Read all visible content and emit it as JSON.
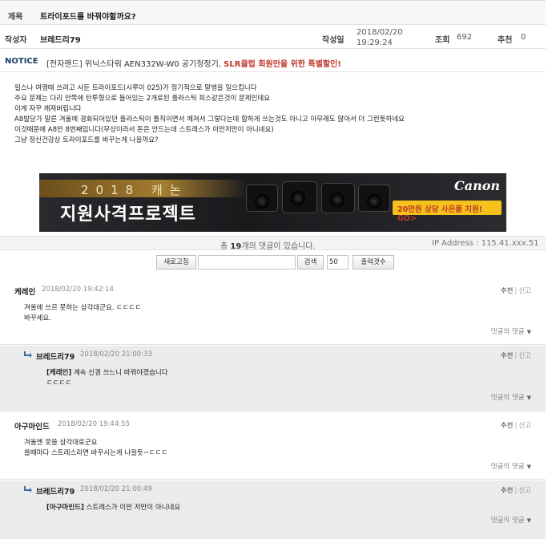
{
  "post": {
    "title_label": "제목",
    "title": "트라이포드를 바꿔야할까요?",
    "author_label": "작성자",
    "author": "브레드리79",
    "date_label": "작성일",
    "date": "2018/02/20",
    "time": "19:29:24",
    "views_label": "조회",
    "views": "692",
    "recommend_label": "추천",
    "recommend": "0"
  },
  "notice": {
    "tag": "NOTICE",
    "text": "[전자랜드] 위닉스타워 AEN332W-W0 공기청정기, ",
    "highlight": "SLR클럽 회원만을 위한 특별할인!"
  },
  "body_lines": [
    "필스나 여행때 쓰려고 사둔 트라이포드(시루이 025)가 정기적으로 말썽을 일으킵니다",
    "주요 문제는 다리 안쪽에 탄투형으로 들어있는 2개로된 플라스틱 피스같은것이 문제인데요",
    "이게 자꾸 깨져버립니다",
    "A8발당가 말른 겨울에 경화되어있던 플라스틱이 틀직이면서 깨져서 그렇다는데 함하게 쓰는것도 아니고 아무래도 않아서 더 그런듯하네요",
    "이것때문에 A8만 8번째입니다(무상이라서 돈은 안드는데 스트레스가 이만저만이 아니네요)",
    "그냥 정신건강상 트라이포드를 바꾸는게 나을까요?"
  ],
  "banner": {
    "year": "2018 캐논",
    "headline": "지원사격프로젝트",
    "brand": "Canon",
    "promo": "20만원 상당 사은품 지원! GO>"
  },
  "comments_info": {
    "prefix": "총 ",
    "count": "19",
    "suffix": "개의 댓글이 있습니다.",
    "ip": "IP Address : 115.41.xxx.51"
  },
  "toolbar": {
    "refresh": "새로고침",
    "search_placeholder": "",
    "search": "검색",
    "count_value": "50",
    "output_count": "출력갯수"
  },
  "labels": {
    "recommend": "추천",
    "report": "신고",
    "reply": "댓글의 댓글"
  },
  "comments": [
    {
      "name": "케레인",
      "time": "2018/02/20 19:42:14",
      "lines": [
        "겨울에 쓰르 못하는 삼각대군요. ㄷㄷㄷㄷ",
        "바꾸세요."
      ],
      "is_reply": false,
      "mention": ""
    },
    {
      "name": "브레드리79",
      "time": "2018/02/20 21:00:33",
      "mention": "[케레인]",
      "lines": [
        "계속 신경 쓰느니 바꿔야겠습니다",
        "ㄷㄷㄷㄷ"
      ],
      "is_reply": true
    },
    {
      "name": "아구마인드",
      "time": "2018/02/20 19:44:55",
      "lines": [
        "겨울엔 못쓸 삼각대로군요",
        "쓸때마다 스트레스라면 바꾸시는게 나을듯~ㄷㄷㄷ"
      ],
      "is_reply": false,
      "mention": ""
    },
    {
      "name": "브레드리79",
      "time": "2018/02/20 21:00:49",
      "mention": "[아구마인드]",
      "lines": [
        "스트레스가 이만 저만이 아니네요"
      ],
      "is_reply": true
    }
  ]
}
